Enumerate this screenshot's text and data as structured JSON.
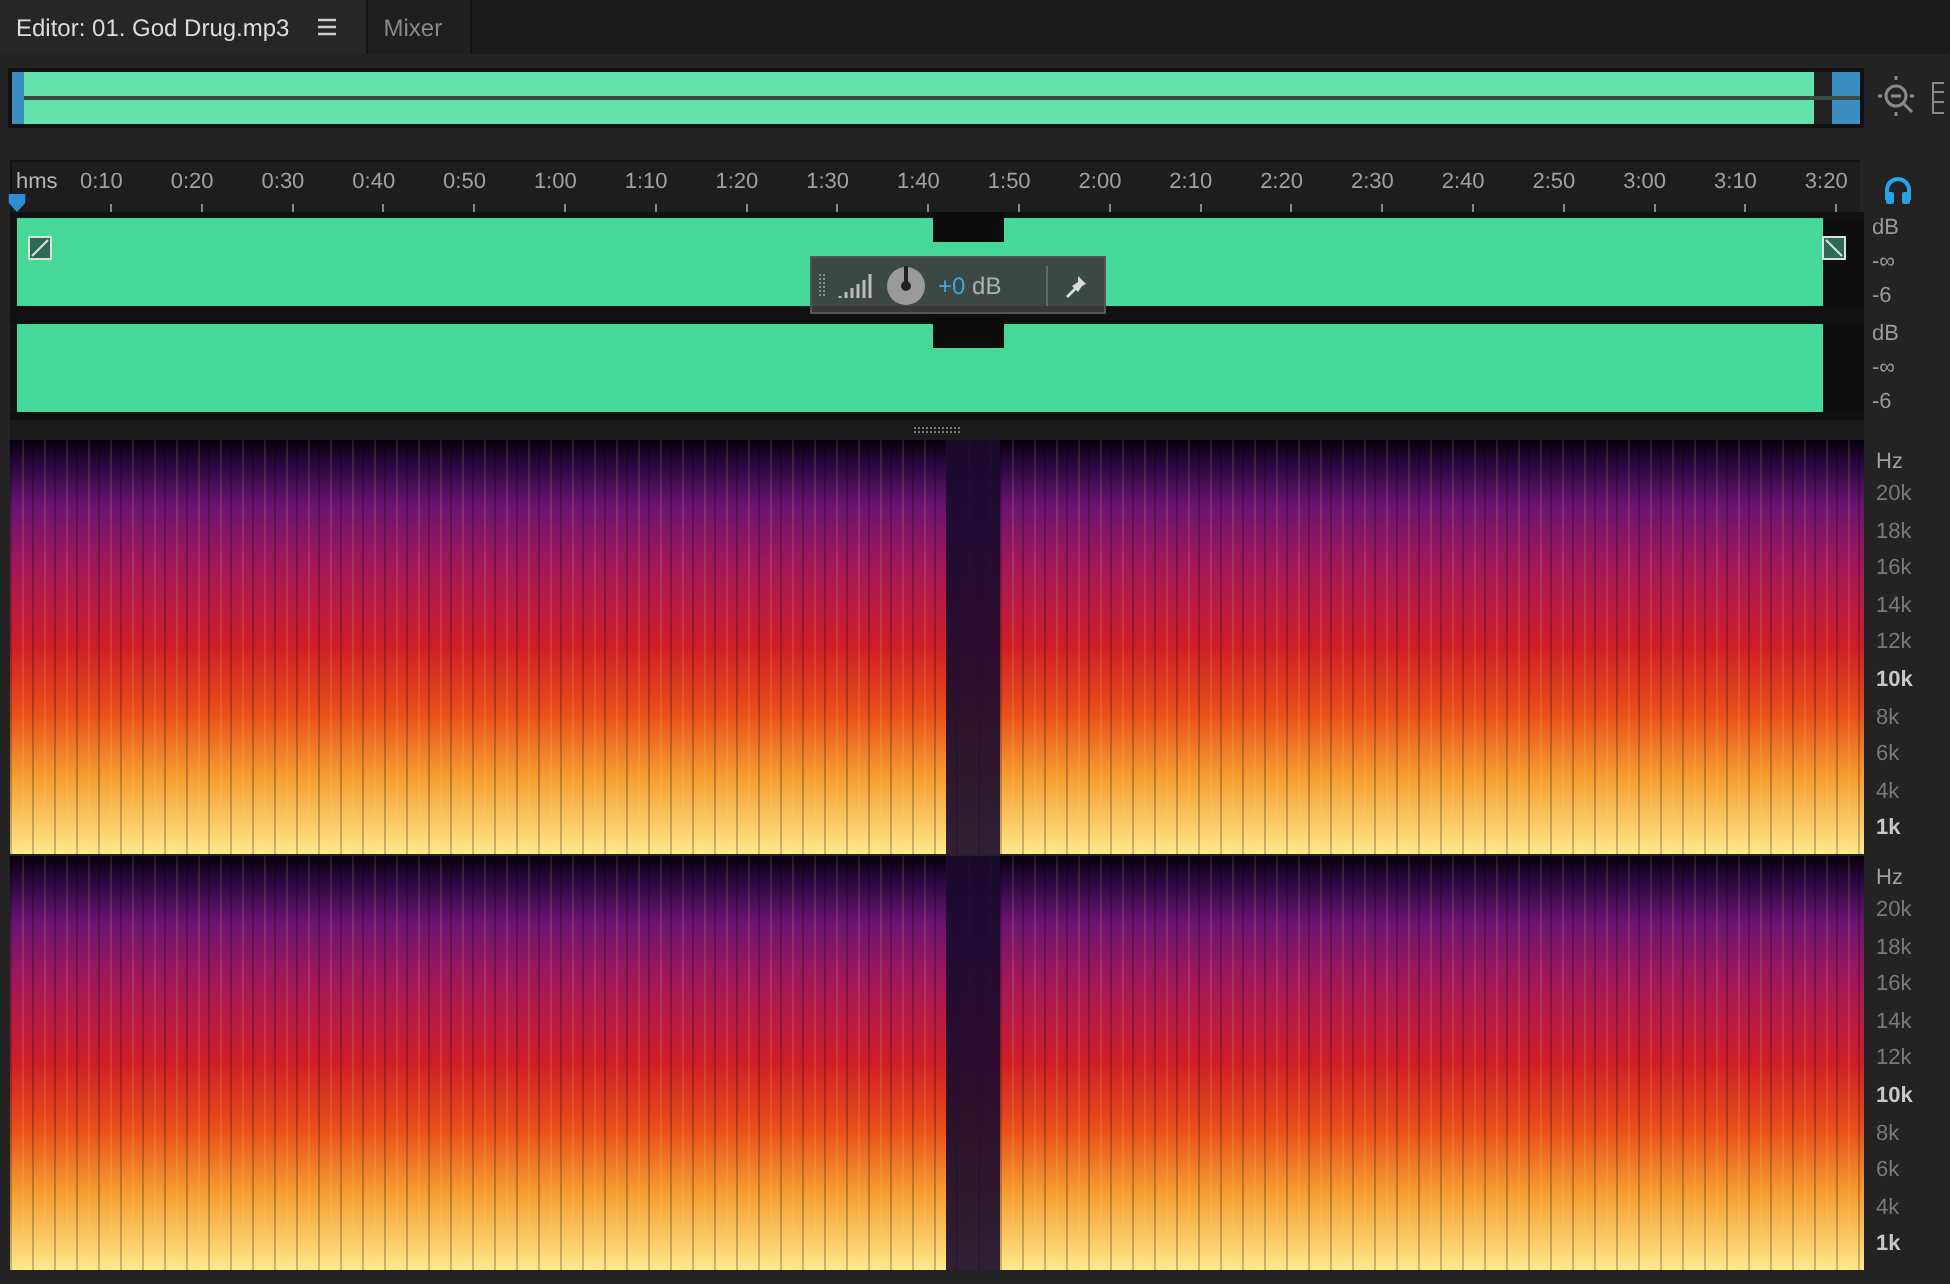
{
  "tabs": [
    {
      "label": "Editor: 01. God Drug.mp3",
      "selected": true,
      "menu": true
    },
    {
      "label": "Mixer",
      "selected": false,
      "menu": false
    }
  ],
  "timeline": {
    "unit": "hms",
    "ticks": [
      "0:10",
      "0:20",
      "0:30",
      "0:40",
      "0:50",
      "1:00",
      "1:10",
      "1:20",
      "1:30",
      "1:40",
      "1:50",
      "2:00",
      "2:10",
      "2:20",
      "2:30",
      "2:40",
      "2:50",
      "3:00",
      "3:10",
      "3:20"
    ]
  },
  "waveform": {
    "channels": [
      {
        "scale": [
          "dB",
          "-∞",
          "-6"
        ]
      },
      {
        "scale": [
          "dB",
          "-∞",
          "-6"
        ]
      }
    ]
  },
  "hud": {
    "value": "+0",
    "unit": "dB"
  },
  "spectrogram": {
    "channels": [
      {
        "unit": "Hz",
        "labels": [
          {
            "text": "20k",
            "major": false
          },
          {
            "text": "18k",
            "major": false
          },
          {
            "text": "16k",
            "major": false
          },
          {
            "text": "14k",
            "major": false
          },
          {
            "text": "12k",
            "major": false
          },
          {
            "text": "10k",
            "major": true
          },
          {
            "text": "8k",
            "major": false
          },
          {
            "text": "6k",
            "major": false
          },
          {
            "text": "4k",
            "major": false
          },
          {
            "text": "1k",
            "major": true
          }
        ]
      },
      {
        "unit": "Hz",
        "labels": [
          {
            "text": "20k",
            "major": false
          },
          {
            "text": "18k",
            "major": false
          },
          {
            "text": "16k",
            "major": false
          },
          {
            "text": "14k",
            "major": false
          },
          {
            "text": "12k",
            "major": false
          },
          {
            "text": "10k",
            "major": true
          },
          {
            "text": "8k",
            "major": false
          },
          {
            "text": "6k",
            "major": false
          },
          {
            "text": "4k",
            "major": false
          },
          {
            "text": "1k",
            "major": true
          }
        ]
      }
    ]
  }
}
